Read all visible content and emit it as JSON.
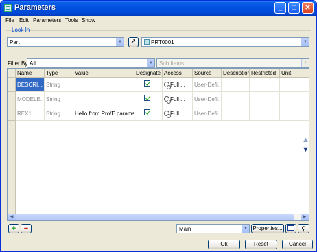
{
  "window": {
    "title": "Parameters"
  },
  "menu": [
    "File",
    "Edit",
    "Parameters",
    "Tools",
    "Show"
  ],
  "look_in": {
    "label": "Look In",
    "scope_value": "Part",
    "object_value": "PRT0001"
  },
  "filter": {
    "label": "Filter By",
    "value": "All",
    "sub_items_label": "Sub Items"
  },
  "table": {
    "columns": [
      "Name",
      "Type",
      "Value",
      "Designate",
      "Access",
      "Source",
      "Description",
      "Restricted",
      "Unit"
    ],
    "rows": [
      {
        "name": "DESCRI...",
        "type": "String",
        "value": "",
        "designate": true,
        "access": "Full",
        "access_more": "...",
        "source": "User-Defi..."
      },
      {
        "name": "MODELE...",
        "type": "String",
        "value": "",
        "designate": true,
        "access": "Full",
        "access_more": "...",
        "source": "User-Defi..."
      },
      {
        "name": "REX1",
        "type": "String",
        "value": "Hello from Pro/E params",
        "designate": true,
        "access": "Full",
        "access_more": "...",
        "source": "User-Defi..."
      }
    ]
  },
  "bottom": {
    "add_icon": "+",
    "remove_icon": "−",
    "view_value": "Main",
    "properties_label": "Properties...",
    "ok_label": "Ok",
    "reset_label": "Reset",
    "cancel_label": "Cancel"
  },
  "colors": {
    "titlebar": "#0050e0",
    "selection": "#316ac5",
    "add_green": "#1a9a1a",
    "remove_red": "#cc2020"
  }
}
